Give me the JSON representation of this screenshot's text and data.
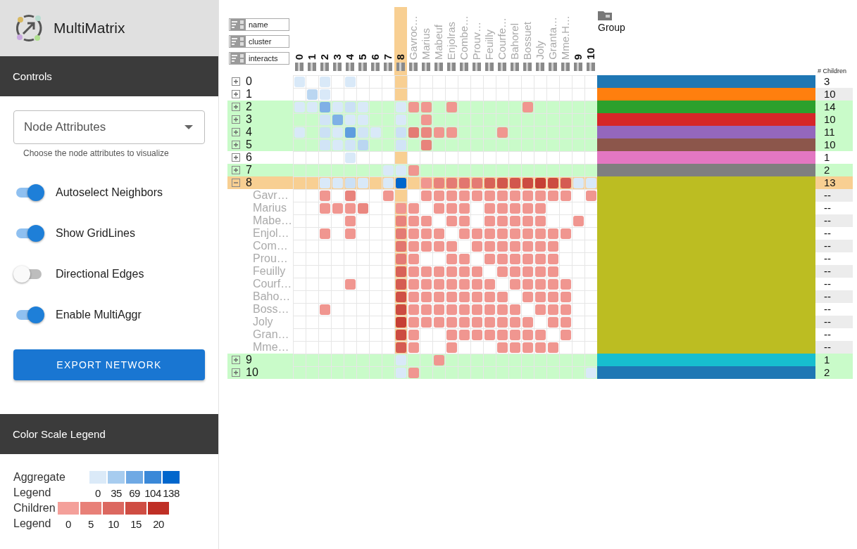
{
  "app": {
    "title": "MultiMatrix"
  },
  "controls": {
    "heading": "Controls",
    "select": {
      "placeholder": "Node Attributes",
      "helper": "Choose the node attributes to visualize"
    },
    "switches": [
      {
        "label": "Autoselect Neighbors",
        "on": true
      },
      {
        "label": "Show GridLines",
        "on": true
      },
      {
        "label": "Directional Edges",
        "on": false
      },
      {
        "label": "Enable MultiAggr",
        "on": true
      }
    ],
    "export_button": "EXPORT NETWORK"
  },
  "legend": {
    "heading": "Color Scale Legend",
    "scales": [
      {
        "kind": "aggregate",
        "title": "Aggregate",
        "subtitle": "Legend",
        "swatches": [
          {
            "color": "#dbeaf8",
            "label": "0"
          },
          {
            "color": "#a7ccef",
            "label": "35"
          },
          {
            "color": "#6fa9e4",
            "label": "69"
          },
          {
            "color": "#3a88d8",
            "label": "104"
          },
          {
            "color": "#0066cc",
            "label": "138"
          }
        ]
      },
      {
        "kind": "children",
        "title": "Children",
        "subtitle": "Legend",
        "swatches": [
          {
            "color": "#f4a09a",
            "label": "0"
          },
          {
            "color": "#e88078",
            "label": "5"
          },
          {
            "color": "#dc6860",
            "label": "10"
          },
          {
            "color": "#cf4d43",
            "label": "15"
          },
          {
            "color": "#bf2f25",
            "label": "20"
          }
        ]
      }
    ]
  },
  "matrix": {
    "sort_buttons": [
      "name",
      "cluster",
      "interacts"
    ],
    "group_header": "Group",
    "count_header": "# Children",
    "columns": [
      {
        "label": "0",
        "kind": "group",
        "selected": false
      },
      {
        "label": "1",
        "kind": "group",
        "selected": false
      },
      {
        "label": "2",
        "kind": "group",
        "selected": false
      },
      {
        "label": "3",
        "kind": "group",
        "selected": false
      },
      {
        "label": "4",
        "kind": "group",
        "selected": false
      },
      {
        "label": "5",
        "kind": "group",
        "selected": false
      },
      {
        "label": "6",
        "kind": "group",
        "selected": false
      },
      {
        "label": "7",
        "kind": "group",
        "selected": false
      },
      {
        "label": "8",
        "kind": "group",
        "selected": true
      },
      {
        "label": "Gavroc…",
        "kind": "child",
        "selected": false
      },
      {
        "label": "Marius",
        "kind": "child",
        "selected": false
      },
      {
        "label": "Mabeuf",
        "kind": "child",
        "selected": false
      },
      {
        "label": "Enjolras",
        "kind": "child",
        "selected": false
      },
      {
        "label": "Combe…",
        "kind": "child",
        "selected": false
      },
      {
        "label": "Prouv…",
        "kind": "child",
        "selected": false
      },
      {
        "label": "Feuilly",
        "kind": "child",
        "selected": false
      },
      {
        "label": "Courfe…",
        "kind": "child",
        "selected": false
      },
      {
        "label": "Bahorel",
        "kind": "child",
        "selected": false
      },
      {
        "label": "Bossuet",
        "kind": "child",
        "selected": false
      },
      {
        "label": "Joly",
        "kind": "child",
        "selected": false
      },
      {
        "label": "Granta…",
        "kind": "child",
        "selected": false
      },
      {
        "label": "Mme.H…",
        "kind": "child",
        "selected": false
      },
      {
        "label": "9",
        "kind": "group",
        "selected": false
      },
      {
        "label": "10",
        "kind": "group",
        "selected": false
      }
    ],
    "rows": [
      {
        "label": "0",
        "expanded": false,
        "selected": false,
        "neighbor": false,
        "color": "#1f77b4",
        "count": "3",
        "cells": [
          {
            "color": "#d9e9f8"
          },
          null,
          {
            "color": "#d9e9f8"
          },
          null,
          {
            "color": "#d9e9f8"
          },
          null,
          null,
          null,
          null,
          null,
          null,
          null,
          null,
          null,
          null,
          null,
          null,
          null,
          null,
          null,
          null,
          null,
          null,
          null
        ]
      },
      {
        "label": "1",
        "expanded": false,
        "selected": false,
        "neighbor": false,
        "color": "#ff7f0e",
        "count": "10",
        "cells": [
          null,
          {
            "color": "#bad6f1"
          },
          {
            "color": "#d9e9f8"
          },
          null,
          null,
          null,
          null,
          null,
          null,
          null,
          null,
          null,
          null,
          null,
          null,
          null,
          null,
          null,
          null,
          null,
          null,
          null,
          null,
          null
        ]
      },
      {
        "label": "2",
        "expanded": false,
        "selected": false,
        "neighbor": true,
        "color": "#2ca02c",
        "count": "14",
        "cells": [
          {
            "color": "#d9e9f8"
          },
          {
            "color": "#d9e9f8"
          },
          {
            "color": "#7fb0e6"
          },
          {
            "color": "#d9e9f8"
          },
          {
            "color": "#cbe0f5"
          },
          {
            "color": "#d9e9f8"
          },
          null,
          null,
          {
            "color": "#d9e9f8"
          },
          {
            "color": "#f09690"
          },
          {
            "color": "#f09690"
          },
          null,
          {
            "color": "#f09690"
          },
          null,
          null,
          null,
          null,
          null,
          {
            "color": "#f09690"
          },
          null,
          null,
          null,
          null,
          null
        ]
      },
      {
        "label": "3",
        "expanded": false,
        "selected": false,
        "neighbor": true,
        "color": "#d62728",
        "count": "10",
        "cells": [
          null,
          null,
          {
            "color": "#d1e4f6"
          },
          {
            "color": "#7fb0e6"
          },
          {
            "color": "#d9e9f8"
          },
          {
            "color": "#d9e9f8"
          },
          null,
          null,
          {
            "color": "#d9e9f8"
          },
          null,
          {
            "color": "#f09690"
          },
          null,
          null,
          null,
          null,
          null,
          null,
          null,
          null,
          null,
          null,
          null,
          null,
          null
        ]
      },
      {
        "label": "4",
        "expanded": false,
        "selected": false,
        "neighbor": true,
        "color": "#9467bd",
        "count": "11",
        "cells": [
          {
            "color": "#d9e9f8"
          },
          null,
          {
            "color": "#cbe0f5"
          },
          {
            "color": "#d9e9f8"
          },
          {
            "color": "#5f9ddf"
          },
          {
            "color": "#d1e4f6"
          },
          {
            "color": "#d9e9f8"
          },
          null,
          {
            "color": "#cbe0f5"
          },
          {
            "color": "#e47b74"
          },
          {
            "color": "#ea8780"
          },
          {
            "color": "#f09690"
          },
          {
            "color": "#f09690"
          },
          null,
          null,
          null,
          {
            "color": "#f09690"
          },
          null,
          null,
          null,
          null,
          null,
          null,
          null
        ]
      },
      {
        "label": "5",
        "expanded": false,
        "selected": false,
        "neighbor": true,
        "color": "#8c564b",
        "count": "10",
        "cells": [
          null,
          null,
          {
            "color": "#d1e4f6"
          },
          {
            "color": "#d9e9f8"
          },
          {
            "color": "#d1e4f6"
          },
          {
            "color": "#bad6f1"
          },
          null,
          null,
          {
            "color": "#d1e4f6"
          },
          null,
          {
            "color": "#e8837c"
          },
          null,
          null,
          null,
          null,
          null,
          null,
          null,
          null,
          null,
          null,
          null,
          null,
          null
        ]
      },
      {
        "label": "6",
        "expanded": false,
        "selected": false,
        "neighbor": false,
        "color": "#e377c2",
        "count": "1",
        "cells": [
          null,
          null,
          null,
          null,
          {
            "color": "#d9e9f8"
          },
          null,
          null,
          null,
          null,
          null,
          null,
          null,
          null,
          null,
          null,
          null,
          null,
          null,
          null,
          null,
          null,
          null,
          null,
          null
        ]
      },
      {
        "label": "7",
        "expanded": false,
        "selected": false,
        "neighbor": true,
        "color": "#7f7f7f",
        "count": "2",
        "cells": [
          null,
          null,
          null,
          null,
          null,
          null,
          null,
          {
            "color": "#d9e9f8"
          },
          {
            "color": "#d9e9f8"
          },
          {
            "color": "#f09690"
          },
          null,
          null,
          null,
          null,
          null,
          null,
          null,
          null,
          null,
          null,
          null,
          null,
          null,
          null
        ]
      },
      {
        "label": "8",
        "expanded": true,
        "selected": true,
        "neighbor": false,
        "color": "#bcbd22",
        "count": "13",
        "cells": [
          null,
          null,
          {
            "color": "#d9e9f8"
          },
          {
            "color": "#d9e9f8"
          },
          {
            "color": "#cbe0f5"
          },
          {
            "color": "#d9e9f8"
          },
          null,
          {
            "color": "#d9e9f8"
          },
          {
            "color": "#0066cc"
          },
          null,
          {
            "color": "#f09690"
          },
          {
            "color": "#e8837c"
          },
          {
            "color": "#e47b74"
          },
          {
            "color": "#e2766f"
          },
          {
            "color": "#e47b74"
          },
          {
            "color": "#d86258"
          },
          {
            "color": "#d2574d"
          },
          {
            "color": "#d2574d"
          },
          {
            "color": "#cc4b41"
          },
          {
            "color": "#c63f35"
          },
          {
            "color": "#cc4b41"
          },
          {
            "color": "#d55c52"
          },
          {
            "color": "#d9e9f8"
          },
          {
            "color": "#d9e9f8"
          }
        ],
        "children": [
          {
            "label": "Gavr…",
            "count": "--",
            "cells": [
              null,
              null,
              {
                "color": "#f09690"
              },
              null,
              {
                "color": "#e8837c"
              },
              null,
              null,
              {
                "color": "#f09690"
              },
              null,
              null,
              {
                "color": "#f09690"
              },
              {
                "color": "#f09690"
              },
              {
                "color": "#f09690"
              },
              {
                "color": "#f09690"
              },
              {
                "color": "#f09690"
              },
              {
                "color": "#f09690"
              },
              {
                "color": "#f09690"
              },
              {
                "color": "#f09690"
              },
              {
                "color": "#f09690"
              },
              {
                "color": "#f09690"
              },
              {
                "color": "#f09690"
              },
              {
                "color": "#f09690"
              },
              null,
              {
                "color": "#f09690"
              }
            ]
          },
          {
            "label": "Marius",
            "count": "--",
            "cells": [
              null,
              null,
              {
                "color": "#f09690"
              },
              {
                "color": "#f09690"
              },
              {
                "color": "#f09690"
              },
              {
                "color": "#ea8780"
              },
              null,
              null,
              {
                "color": "#f09690"
              },
              {
                "color": "#f09690"
              },
              null,
              {
                "color": "#f09690"
              },
              {
                "color": "#f09690"
              },
              {
                "color": "#f09690"
              },
              null,
              {
                "color": "#f09690"
              },
              {
                "color": "#f09690"
              },
              {
                "color": "#f09690"
              },
              {
                "color": "#f09690"
              },
              {
                "color": "#f09690"
              },
              null,
              null,
              null,
              null
            ]
          },
          {
            "label": "Mabe…",
            "count": "--",
            "cells": [
              null,
              null,
              null,
              null,
              {
                "color": "#f09690"
              },
              null,
              null,
              null,
              {
                "color": "#e8837c"
              },
              {
                "color": "#f09690"
              },
              {
                "color": "#f09690"
              },
              null,
              {
                "color": "#f09690"
              },
              {
                "color": "#f09690"
              },
              null,
              {
                "color": "#f09690"
              },
              {
                "color": "#f09690"
              },
              {
                "color": "#f09690"
              },
              {
                "color": "#f09690"
              },
              {
                "color": "#f09690"
              },
              null,
              null,
              {
                "color": "#f09690"
              },
              null
            ]
          },
          {
            "label": "Enjol…",
            "count": "--",
            "cells": [
              null,
              null,
              {
                "color": "#f09690"
              },
              null,
              {
                "color": "#f09690"
              },
              null,
              null,
              null,
              {
                "color": "#e47b74"
              },
              {
                "color": "#f09690"
              },
              {
                "color": "#f09690"
              },
              {
                "color": "#f09690"
              },
              null,
              {
                "color": "#f09690"
              },
              {
                "color": "#f09690"
              },
              {
                "color": "#f09690"
              },
              {
                "color": "#f09690"
              },
              {
                "color": "#f09690"
              },
              {
                "color": "#f09690"
              },
              {
                "color": "#f09690"
              },
              {
                "color": "#f09690"
              },
              {
                "color": "#f09690"
              },
              null,
              null
            ]
          },
          {
            "label": "Com…",
            "count": "--",
            "cells": [
              null,
              null,
              null,
              null,
              null,
              null,
              null,
              null,
              {
                "color": "#e2766f"
              },
              {
                "color": "#f09690"
              },
              {
                "color": "#f09690"
              },
              {
                "color": "#f09690"
              },
              {
                "color": "#f09690"
              },
              null,
              {
                "color": "#f09690"
              },
              {
                "color": "#f09690"
              },
              {
                "color": "#f09690"
              },
              {
                "color": "#f09690"
              },
              {
                "color": "#f09690"
              },
              {
                "color": "#f09690"
              },
              {
                "color": "#f09690"
              },
              null,
              null,
              null
            ]
          },
          {
            "label": "Prou…",
            "count": "--",
            "cells": [
              null,
              null,
              null,
              null,
              null,
              null,
              null,
              null,
              {
                "color": "#e47b74"
              },
              {
                "color": "#f09690"
              },
              null,
              null,
              {
                "color": "#f09690"
              },
              {
                "color": "#f09690"
              },
              null,
              {
                "color": "#f09690"
              },
              {
                "color": "#f09690"
              },
              {
                "color": "#f09690"
              },
              {
                "color": "#f09690"
              },
              {
                "color": "#f09690"
              },
              {
                "color": "#f09690"
              },
              null,
              null,
              null
            ]
          },
          {
            "label": "Feuilly",
            "count": "--",
            "cells": [
              null,
              null,
              null,
              null,
              null,
              null,
              null,
              null,
              {
                "color": "#d86258"
              },
              {
                "color": "#f09690"
              },
              {
                "color": "#f09690"
              },
              {
                "color": "#f09690"
              },
              {
                "color": "#f09690"
              },
              {
                "color": "#f09690"
              },
              {
                "color": "#f09690"
              },
              null,
              {
                "color": "#f09690"
              },
              {
                "color": "#f09690"
              },
              {
                "color": "#f09690"
              },
              {
                "color": "#f09690"
              },
              {
                "color": "#f09690"
              },
              null,
              null,
              null
            ]
          },
          {
            "label": "Courf…",
            "count": "--",
            "cells": [
              null,
              null,
              null,
              null,
              {
                "color": "#f09690"
              },
              null,
              null,
              null,
              {
                "color": "#d55c52"
              },
              {
                "color": "#f09690"
              },
              {
                "color": "#f09690"
              },
              {
                "color": "#f09690"
              },
              {
                "color": "#f09690"
              },
              {
                "color": "#f09690"
              },
              {
                "color": "#f09690"
              },
              {
                "color": "#f09690"
              },
              null,
              {
                "color": "#f09690"
              },
              {
                "color": "#f09690"
              },
              {
                "color": "#f09690"
              },
              {
                "color": "#f09690"
              },
              {
                "color": "#f09690"
              },
              null,
              null
            ]
          },
          {
            "label": "Baho…",
            "count": "--",
            "cells": [
              null,
              null,
              null,
              null,
              null,
              null,
              null,
              null,
              {
                "color": "#cf5046"
              },
              {
                "color": "#f09690"
              },
              {
                "color": "#f09690"
              },
              {
                "color": "#f09690"
              },
              {
                "color": "#f09690"
              },
              {
                "color": "#f09690"
              },
              {
                "color": "#f09690"
              },
              {
                "color": "#f09690"
              },
              {
                "color": "#f09690"
              },
              null,
              {
                "color": "#f09690"
              },
              {
                "color": "#f09690"
              },
              {
                "color": "#f09690"
              },
              {
                "color": "#f09690"
              },
              null,
              null
            ]
          },
          {
            "label": "Boss…",
            "count": "--",
            "cells": [
              null,
              null,
              {
                "color": "#f09690"
              },
              null,
              null,
              null,
              null,
              null,
              {
                "color": "#cc4b41"
              },
              {
                "color": "#f09690"
              },
              {
                "color": "#f09690"
              },
              {
                "color": "#f09690"
              },
              {
                "color": "#f09690"
              },
              {
                "color": "#f09690"
              },
              {
                "color": "#f09690"
              },
              {
                "color": "#f09690"
              },
              {
                "color": "#f09690"
              },
              {
                "color": "#f09690"
              },
              null,
              {
                "color": "#f09690"
              },
              {
                "color": "#f09690"
              },
              {
                "color": "#f09690"
              },
              null,
              null
            ]
          },
          {
            "label": "Joly",
            "count": "--",
            "cells": [
              null,
              null,
              null,
              null,
              null,
              null,
              null,
              null,
              {
                "color": "#c63f35"
              },
              {
                "color": "#f09690"
              },
              {
                "color": "#f09690"
              },
              {
                "color": "#f09690"
              },
              {
                "color": "#f09690"
              },
              {
                "color": "#f09690"
              },
              {
                "color": "#f09690"
              },
              {
                "color": "#f09690"
              },
              {
                "color": "#f09690"
              },
              {
                "color": "#f09690"
              },
              {
                "color": "#f09690"
              },
              null,
              {
                "color": "#f09690"
              },
              {
                "color": "#f09690"
              },
              null,
              null
            ]
          },
          {
            "label": "Gran…",
            "count": "--",
            "cells": [
              null,
              null,
              null,
              null,
              null,
              null,
              null,
              null,
              {
                "color": "#cc4b41"
              },
              {
                "color": "#f09690"
              },
              null,
              null,
              {
                "color": "#f09690"
              },
              {
                "color": "#f09690"
              },
              {
                "color": "#f09690"
              },
              {
                "color": "#f09690"
              },
              {
                "color": "#f09690"
              },
              {
                "color": "#f09690"
              },
              {
                "color": "#f09690"
              },
              {
                "color": "#f09690"
              },
              null,
              {
                "color": "#f09690"
              },
              null,
              null
            ]
          },
          {
            "label": "Mme…",
            "count": "--",
            "cells": [
              null,
              null,
              null,
              null,
              null,
              null,
              null,
              null,
              {
                "color": "#d55c52"
              },
              {
                "color": "#f09690"
              },
              null,
              null,
              {
                "color": "#f09690"
              },
              null,
              null,
              null,
              {
                "color": "#f09690"
              },
              {
                "color": "#f09690"
              },
              {
                "color": "#f09690"
              },
              {
                "color": "#f09690"
              },
              {
                "color": "#f09690"
              },
              null,
              null,
              null
            ]
          }
        ]
      },
      {
        "label": "9",
        "expanded": false,
        "selected": false,
        "neighbor": true,
        "color": "#17becf",
        "count": "1",
        "cells": [
          null,
          null,
          null,
          null,
          null,
          null,
          null,
          null,
          {
            "color": "#d9e9f8"
          },
          null,
          null,
          {
            "color": "#f09690"
          },
          null,
          null,
          null,
          null,
          null,
          null,
          null,
          null,
          null,
          null,
          null,
          null
        ]
      },
      {
        "label": "10",
        "expanded": false,
        "selected": false,
        "neighbor": true,
        "color": "#1f77b4",
        "count": "2",
        "cells": [
          null,
          null,
          null,
          null,
          null,
          null,
          null,
          null,
          {
            "color": "#d9e9f8"
          },
          {
            "color": "#f09690"
          },
          null,
          null,
          null,
          null,
          null,
          null,
          null,
          null,
          null,
          null,
          null,
          null,
          null,
          {
            "color": "#d9e9f8"
          }
        ]
      }
    ]
  }
}
